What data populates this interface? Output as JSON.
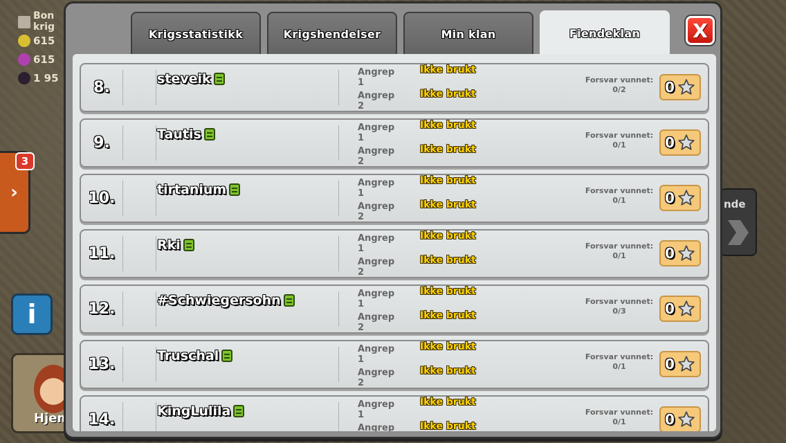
{
  "background": {
    "stats": [
      {
        "icon": "crossed-swords-icon",
        "text": "Bon",
        "text2": "krig",
        "color": "#b8b0a0"
      },
      {
        "icon": "gold-coin-icon",
        "text": "615",
        "color": "#d8c030"
      },
      {
        "icon": "elixir-drop-icon",
        "text": "615",
        "color": "#b040b0"
      },
      {
        "icon": "dark-elixir-icon",
        "text": "1 95",
        "color": "#2a2030"
      }
    ],
    "side_badge": "3",
    "side_arrow": "›",
    "info_label": "i",
    "hero_label": "Hjem",
    "right_label": "nde"
  },
  "tabs": [
    {
      "label": "Krigsstatistikk",
      "active": false
    },
    {
      "label": "Krigshendelser",
      "active": false
    },
    {
      "label": "Min klan",
      "active": false
    },
    {
      "label": "Fiendeklan",
      "active": true
    }
  ],
  "close_label": "X",
  "labels": {
    "attack1": "Angrep 1",
    "attack2": "Angrep 2",
    "defense": "Forsvar vunnet:"
  },
  "members": [
    {
      "rank": "8.",
      "name": "steveik",
      "attack1": "Ikke brukt",
      "attack2": "Ikke brukt",
      "defense": "0/2",
      "stars": "0"
    },
    {
      "rank": "9.",
      "name": "Tautis",
      "attack1": "Ikke brukt",
      "attack2": "Ikke brukt",
      "defense": "0/1",
      "stars": "0"
    },
    {
      "rank": "10.",
      "name": "tirtanium",
      "attack1": "Ikke brukt",
      "attack2": "Ikke brukt",
      "defense": "0/1",
      "stars": "0"
    },
    {
      "rank": "11.",
      "name": "Rki",
      "attack1": "Ikke brukt",
      "attack2": "Ikke brukt",
      "defense": "0/1",
      "stars": "0"
    },
    {
      "rank": "12.",
      "name": "#Schwiegersohn",
      "attack1": "Ikke brukt",
      "attack2": "Ikke brukt",
      "defense": "0/3",
      "stars": "0"
    },
    {
      "rank": "13.",
      "name": "Truschal",
      "attack1": "Ikke brukt",
      "attack2": "Ikke brukt",
      "defense": "0/1",
      "stars": "0"
    },
    {
      "rank": "14.",
      "name": "KingLulila",
      "attack1": "Ikke brukt",
      "attack2": "Ikke brukt",
      "defense": "0/1",
      "stars": "0"
    }
  ]
}
